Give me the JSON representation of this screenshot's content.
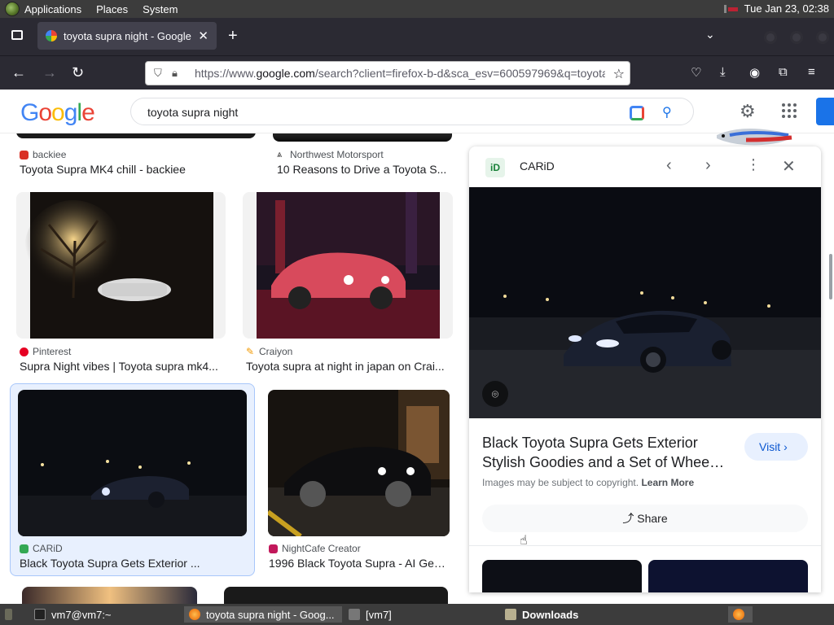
{
  "system_panel": {
    "menus": [
      "Applications",
      "Places",
      "System"
    ],
    "clock": "Tue Jan 23, 02:38"
  },
  "browser": {
    "tab_title": "toyota supra night - Google",
    "url_prefix": "https://www.",
    "url_domain": "google.com",
    "url_rest": "/search?client=firefox-b-d&sca_esv=600597969&q=toyota"
  },
  "google": {
    "logo": [
      "G",
      "o",
      "o",
      "g",
      "l",
      "e"
    ],
    "query": "toyota supra night"
  },
  "results": [
    {
      "source": "backiee",
      "caption": "Toyota Supra MK4 chill - backiee"
    },
    {
      "source": "Northwest Motorsport",
      "caption": "10 Reasons to Drive a Toyota S..."
    },
    {
      "source": "Pinterest",
      "caption": "Supra Night vibes | Toyota supra mk4..."
    },
    {
      "source": "Craiyon",
      "caption": "Toyota supra at night in japan on Crai..."
    },
    {
      "source": "CARiD",
      "caption": "Black Toyota Supra Gets Exterior ..."
    },
    {
      "source": "NightCafe Creator",
      "caption": "1996 Black Toyota Supra - AI Gen..."
    }
  ],
  "panel": {
    "site_name": "CARiD",
    "site_icon": "iD",
    "title_line1": "Black Toyota Supra Gets Exterior",
    "title_line2": "Stylish Goodies and a Set of Wheels...",
    "visit_label": "Visit",
    "copyright": "Images may be subject to copyright.",
    "learn_more": "Learn More",
    "share_label": "Share"
  },
  "taskbar": {
    "items": [
      "vm7@vm7:~",
      "toyota supra night - Goog...",
      "[vm7]",
      "Downloads"
    ]
  },
  "colors": {
    "accent": "#1a73e8",
    "google_blue": "#4285f4",
    "google_red": "#ea4335",
    "google_yellow": "#fbbc05",
    "google_green": "#34a853"
  }
}
